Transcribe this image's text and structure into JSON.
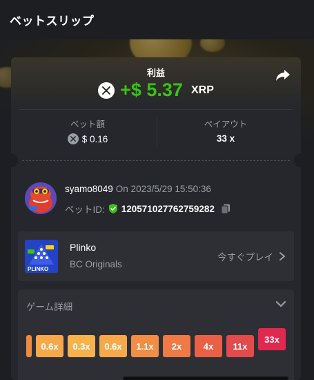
{
  "header": {
    "title": "ベットスリップ"
  },
  "profit": {
    "label": "利益",
    "amount": "+$ 5.37",
    "currency": "XRP"
  },
  "stats": {
    "bet_label": "ベット額",
    "bet_value": "$ 0.16",
    "payout_label": "ペイアウト",
    "payout_value": "33 x"
  },
  "user": {
    "name": "syamo8049",
    "time": "On 2023/5/29 15:50:36",
    "bet_id_label": "ベットID:",
    "bet_id": "120571027762759282"
  },
  "game": {
    "name": "Plinko",
    "provider": "BC Originals",
    "play_label": "今すぐプレイ",
    "thumb_text": "PLINKO"
  },
  "details": {
    "title": "ゲーム詳細",
    "multipliers": [
      {
        "label": "",
        "color": "#f08a3c"
      },
      {
        "label": "0.6x",
        "color": "#f7a94a"
      },
      {
        "label": "0.3x",
        "color": "#f7b24c"
      },
      {
        "label": "0.6x",
        "color": "#f7a94a"
      },
      {
        "label": "1.1x",
        "color": "#f28d47"
      },
      {
        "label": "2x",
        "color": "#ef7a45"
      },
      {
        "label": "4x",
        "color": "#ea6046"
      },
      {
        "label": "11x",
        "color": "#e34a4c"
      },
      {
        "label": "33x",
        "color": "#e0294f",
        "active": true
      }
    ]
  },
  "colors": {
    "profit_green": "#3bc117",
    "background": "#1c1e22",
    "card": "#25272c"
  }
}
